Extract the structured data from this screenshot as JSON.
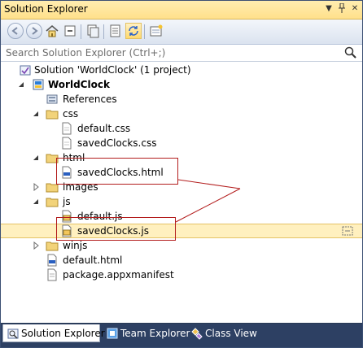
{
  "window": {
    "title": "Solution Explorer"
  },
  "toolbar": {
    "buttons": [
      {
        "name": "back"
      },
      {
        "name": "forward"
      },
      {
        "name": "home"
      },
      {
        "name": "collapse-all"
      },
      {
        "name": "show-all-files"
      },
      {
        "name": "properties"
      },
      {
        "name": "sync-active-document"
      },
      {
        "name": "pending-changes"
      }
    ]
  },
  "search": {
    "placeholder": "Search Solution Explorer (Ctrl+;)"
  },
  "tree": {
    "items": [
      {
        "label": "Solution 'WorldClock' (1 project)",
        "icon": "solution-icon"
      },
      {
        "label": "WorldClock",
        "icon": "project-icon"
      },
      {
        "label": "References",
        "icon": "references-icon"
      },
      {
        "label": "css",
        "icon": "folder-icon"
      },
      {
        "label": "default.css",
        "icon": "css-file-icon"
      },
      {
        "label": "savedClocks.css",
        "icon": "css-file-icon"
      },
      {
        "label": "html",
        "icon": "folder-icon"
      },
      {
        "label": "savedClocks.html",
        "icon": "html-file-icon"
      },
      {
        "label": "images",
        "icon": "folder-icon"
      },
      {
        "label": "js",
        "icon": "folder-icon"
      },
      {
        "label": "default.js",
        "icon": "js-file-icon"
      },
      {
        "label": "savedClocks.js",
        "icon": "js-file-icon"
      },
      {
        "label": "winjs",
        "icon": "folder-icon"
      },
      {
        "label": "default.html",
        "icon": "html-file-icon"
      },
      {
        "label": "package.appxmanifest",
        "icon": "manifest-icon"
      }
    ]
  },
  "tabs": [
    {
      "label": "Solution Explorer",
      "active": true
    },
    {
      "label": "Team Explorer",
      "active": false
    },
    {
      "label": "Class View",
      "active": false
    }
  ],
  "colors": {
    "title_bar": "#ffe08b",
    "selection": "#fff0bf",
    "annotation": "#b31d1d",
    "tab_strip": "#2d4063"
  }
}
